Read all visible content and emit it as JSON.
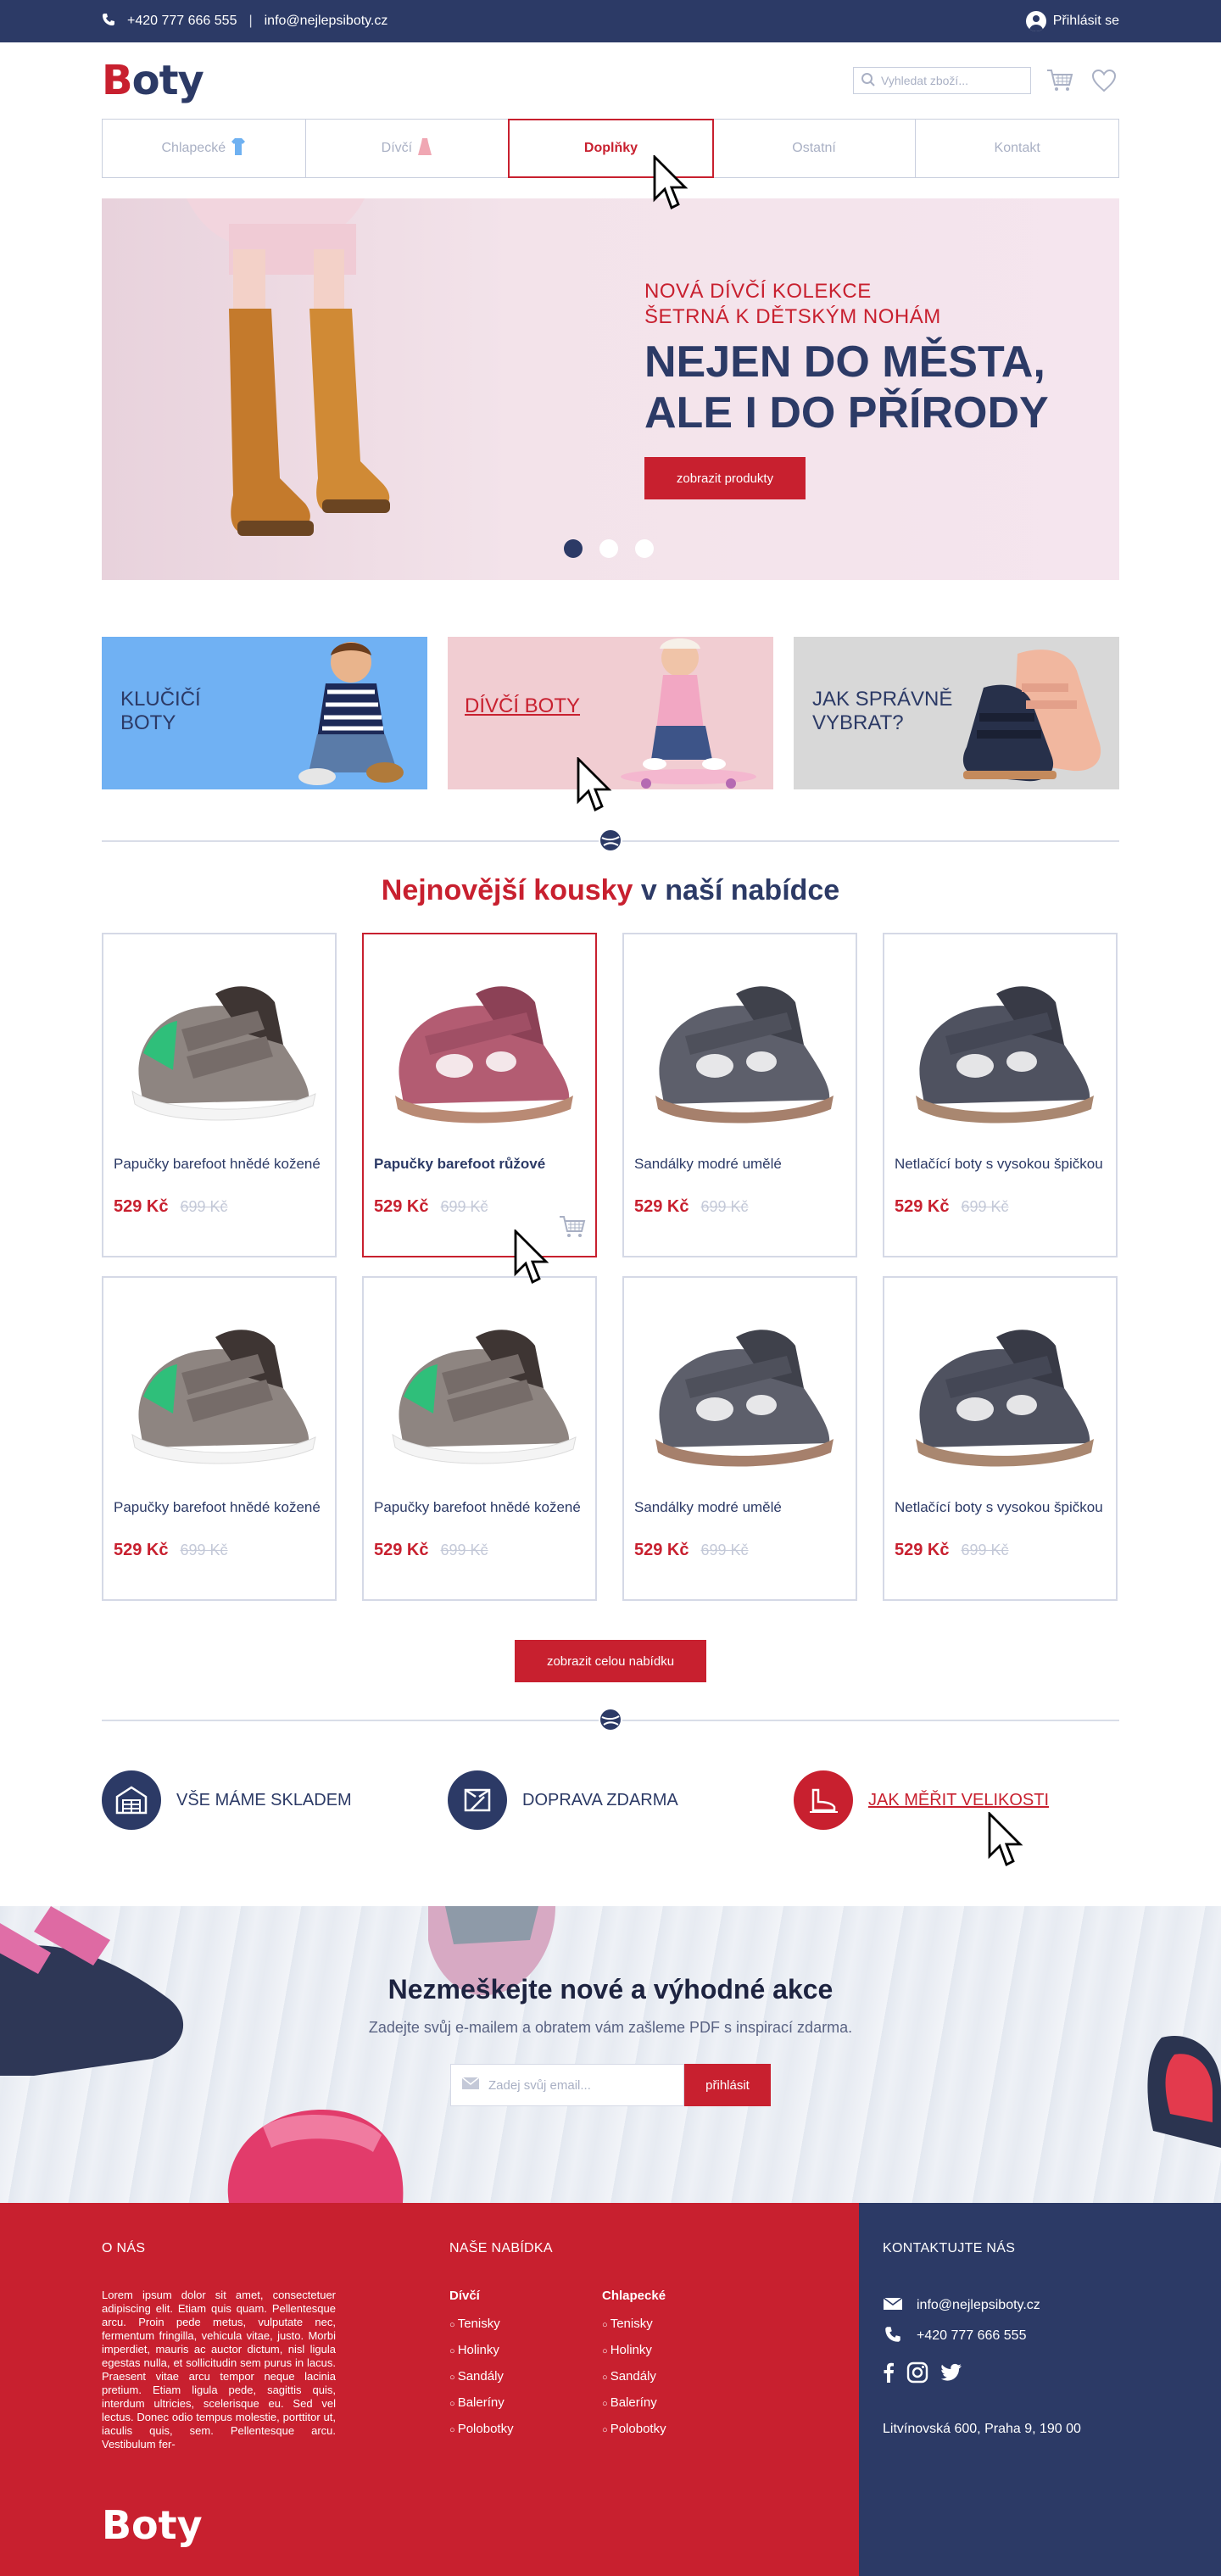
{
  "topbar": {
    "phone": "+420 777 666 555",
    "separator": "|",
    "email": "info@nejlepsiboty.cz",
    "login": "Přihlásit se"
  },
  "header": {
    "logo_first": "B",
    "logo_rest": "oty",
    "search_placeholder": "Vyhledat zboží..."
  },
  "nav": [
    {
      "label": "Chlapecké",
      "icon": "boy-shirt-icon"
    },
    {
      "label": "Dívčí",
      "icon": "girl-dress-icon"
    },
    {
      "label": "Doplňky",
      "active": true
    },
    {
      "label": "Ostatní"
    },
    {
      "label": "Kontakt"
    }
  ],
  "hero": {
    "sub_line1": "NOVÁ DÍVČÍ KOLEKCE",
    "sub_line2": "ŠETRNÁ K DĚTSKÝM NOHÁM",
    "title_line1": "NEJEN DO MĚSTA,",
    "title_line2": "ALE I DO PŘÍRODY",
    "button": "zobrazit produkty",
    "slides": 3,
    "active_slide": 1
  },
  "tiles": [
    {
      "line1": "KLUČIČÍ",
      "line2": "BOTY",
      "bg": "#70b1f3"
    },
    {
      "line1": "DÍVČÍ BOTY",
      "line2": "",
      "bg": "#f1cdd2"
    },
    {
      "line1": "JAK SPRÁVNĚ",
      "line2": "VYBRAT?",
      "bg": "#d8d8d8"
    }
  ],
  "section": {
    "title_red": "Nejnovější kousky",
    "title_blue": "v naší nabídce"
  },
  "products": [
    {
      "name": "Papučky barefoot hnědé kožené",
      "price": "529 Kč",
      "old": "699 Kč",
      "kind": "velcro"
    },
    {
      "name": "Papučky barefoot růžové",
      "price": "529 Kč",
      "old": "699 Kč",
      "kind": "sandal-pink",
      "active": true
    },
    {
      "name": "Sandálky modré umělé",
      "price": "529 Kč",
      "old": "699 Kč",
      "kind": "sandal-gray"
    },
    {
      "name": "Netlačící boty s vysokou špičkou",
      "price": "529 Kč",
      "old": "699 Kč",
      "kind": "sandal-dark"
    },
    {
      "name": "Papučky barefoot hnědé kožené",
      "price": "529 Kč",
      "old": "699 Kč",
      "kind": "velcro"
    },
    {
      "name": "Papučky barefoot hnědé kožené",
      "price": "529 Kč",
      "old": "699 Kč",
      "kind": "velcro"
    },
    {
      "name": "Sandálky modré umělé",
      "price": "529 Kč",
      "old": "699 Kč",
      "kind": "sandal-gray"
    },
    {
      "name": "Netlačící boty s vysokou špičkou",
      "price": "529 Kč",
      "old": "699 Kč",
      "kind": "sandal-dark"
    }
  ],
  "more_button": "zobrazit celou nabídku",
  "features": [
    {
      "label": "VŠE MÁME SKLADEM",
      "icon": "warehouse-icon"
    },
    {
      "label": "DOPRAVA ZDARMA",
      "icon": "delivery-box-icon"
    },
    {
      "label": "JAK MĚŘIT VELIKOSTI",
      "icon": "foot-measure-icon"
    }
  ],
  "newsletter": {
    "title": "Nezmeškejte nové a výhodné akce",
    "text": "Zadejte svůj e-mailem a obratem vám zašleme PDF s inspirací zdarma.",
    "placeholder": "Zadej svůj email...",
    "button": "přihlásit"
  },
  "footer": {
    "about_head": "O NÁS",
    "about_text": "Lorem ipsum dolor sit amet, consectetuer adipiscing elit. Etiam quis quam. Pellentesque arcu. Proin pede metus, vulputate nec, fermentum fringilla, vehicula vitae, justo. Morbi imperdiet, mauris ac auctor dictum, nisl ligula egestas nulla, et sollicitudin sem purus in lacus. Praesent vitae arcu tempor neque lacinia pretium. Etiam ligula pede, sagittis quis, interdum ultricies, scelerisque eu. Sed vel lectus. Donec odio tempus molestie, porttitor ut, iaculis quis, sem. Pellentesque arcu. Vestibulum fer-",
    "offer_head": "NAŠE NABÍDKA",
    "girls_head": "Dívčí",
    "boys_head": "Chlapecké",
    "girls_items": [
      "Tenisky",
      "Holinky",
      "Sandály",
      "Baleríny",
      "Polobotky"
    ],
    "boys_items": [
      "Tenisky",
      "Holinky",
      "Sandály",
      "Baleríny",
      "Polobotky"
    ],
    "contact_head": "KONTAKTUJTE NÁS",
    "email": "info@nejlepsiboty.cz",
    "phone": "+420 777 666 555",
    "address": "Litvínovská 600, Praha 9, 190 00",
    "logo": "Boty"
  },
  "colors": {
    "red": "#c8202f",
    "navy": "#2c3a66",
    "border": "#d5d9e6"
  }
}
